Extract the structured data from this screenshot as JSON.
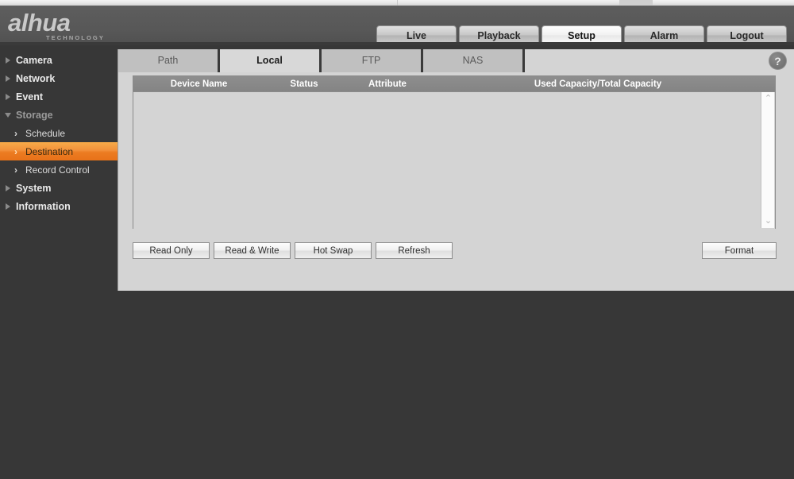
{
  "brand": {
    "name": "alhua",
    "tagline": "TECHNOLOGY"
  },
  "topnav": {
    "items": [
      {
        "label": "Live",
        "active": false
      },
      {
        "label": "Playback",
        "active": false
      },
      {
        "label": "Setup",
        "active": true
      },
      {
        "label": "Alarm",
        "active": false
      },
      {
        "label": "Logout",
        "active": false
      }
    ]
  },
  "sidebar": {
    "items": [
      {
        "label": "Camera",
        "expanded": false
      },
      {
        "label": "Network",
        "expanded": false
      },
      {
        "label": "Event",
        "expanded": false
      },
      {
        "label": "Storage",
        "expanded": true
      },
      {
        "label": "System",
        "expanded": false
      },
      {
        "label": "Information",
        "expanded": false
      }
    ],
    "storage_children": [
      {
        "label": "Schedule",
        "selected": false,
        "chevron": "›"
      },
      {
        "label": "Destination",
        "selected": true,
        "chevron": "›"
      },
      {
        "label": "Record Control",
        "selected": false,
        "chevron": "›"
      }
    ]
  },
  "tabs": [
    {
      "label": "Path",
      "active": false
    },
    {
      "label": "Local",
      "active": true
    },
    {
      "label": "FTP",
      "active": false
    },
    {
      "label": "NAS",
      "active": false
    }
  ],
  "help": {
    "glyph": "?"
  },
  "table": {
    "columns": [
      "Device Name",
      "Status",
      "Attribute",
      "Used Capacity/Total Capacity"
    ],
    "rows": []
  },
  "scrollbar": {
    "up_glyph": "⌃",
    "down_glyph": "⌄"
  },
  "buttons": {
    "read_only": "Read Only",
    "read_write": "Read & Write",
    "hot_swap": "Hot Swap",
    "refresh": "Refresh",
    "format": "Format"
  },
  "colors": {
    "dark_background": "#373737",
    "header": "#585858",
    "panel": "#d4d4d4",
    "accent_orange": "#ec7c22",
    "table_header": "#8a8a8a"
  }
}
